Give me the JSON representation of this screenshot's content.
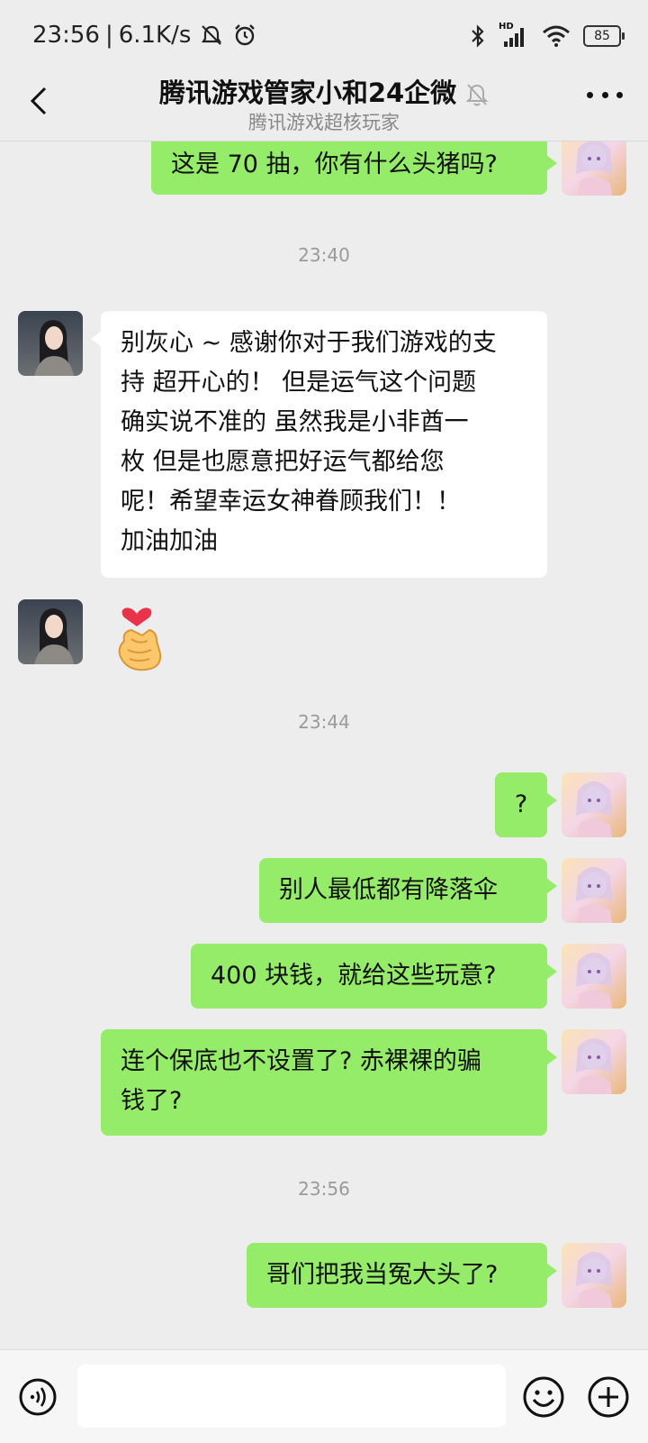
{
  "status_bar": {
    "time": "23:56",
    "speed": "6.1K/s",
    "network_label": "HD",
    "battery": "85"
  },
  "header": {
    "title": "腾讯游戏管家小和24企微",
    "subtitle": "腾讯游戏超核玩家"
  },
  "messages": [
    {
      "type": "text",
      "from": "me",
      "text": "这是 70 抽，你有什么头猪吗?"
    },
    {
      "type": "time",
      "text": "23:40"
    },
    {
      "type": "text",
      "from": "them",
      "lines": [
        "别灰心 ~ 感谢你对于我们游戏的支",
        "持 超开心的！ 但是运气这个问题",
        "确实说不准的 虽然我是小非酋一",
        "枚  但是也愿意把好运气都给您",
        "呢！希望幸运女神眷顾我们！！",
        "加油加油"
      ]
    },
    {
      "type": "sticker",
      "from": "them",
      "sticker": "finger-heart-sticker"
    },
    {
      "type": "time",
      "text": "23:44"
    },
    {
      "type": "text",
      "from": "me",
      "text": "?"
    },
    {
      "type": "text",
      "from": "me",
      "text": "别人最低都有降落伞"
    },
    {
      "type": "text",
      "from": "me",
      "text": "400 块钱，就给这些玩意?"
    },
    {
      "type": "text",
      "from": "me",
      "lines": [
        "连个保底也不设置了?  赤裸裸的骗",
        "钱了?"
      ]
    },
    {
      "type": "time",
      "text": "23:56"
    },
    {
      "type": "text",
      "from": "me",
      "text": "哥们把我当冤大头了?"
    }
  ],
  "input": {
    "value": ""
  },
  "icons": {
    "back": "chevron-left-icon",
    "mute": "bell-off-icon",
    "more": "more-icon",
    "voice": "voice-icon",
    "emoji": "emoji-icon",
    "plus": "plus-icon"
  },
  "colors": {
    "bubble_me": "#95ec69",
    "bubble_them": "#ffffff",
    "background": "#ededed"
  }
}
